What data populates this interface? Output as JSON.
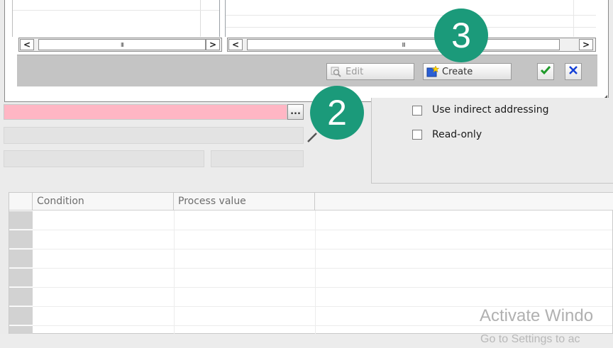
{
  "dialog": {
    "left_scroll": {
      "left_arrow": "<",
      "right_arrow": ">",
      "thumb_grip": "III"
    },
    "right_scroll": {
      "left_arrow": "<",
      "right_arrow": ">",
      "thumb_grip": "III"
    },
    "edit_label": "Edit",
    "create_label": "Create"
  },
  "properties": {
    "browse_label": "...",
    "use_indirect_label": "Use indirect addressing",
    "use_indirect_checked": false,
    "read_only_label": "Read-only",
    "read_only_checked": false
  },
  "table": {
    "columns": [
      "Condition",
      "Process value"
    ]
  },
  "badges": {
    "two": "2",
    "three": "3"
  },
  "watermark": {
    "title": "Activate Windo",
    "subtitle": "Go to Settings to ac"
  },
  "colors": {
    "badge": "#1b9a7a",
    "tag_field_error": "#ffb6c4"
  }
}
